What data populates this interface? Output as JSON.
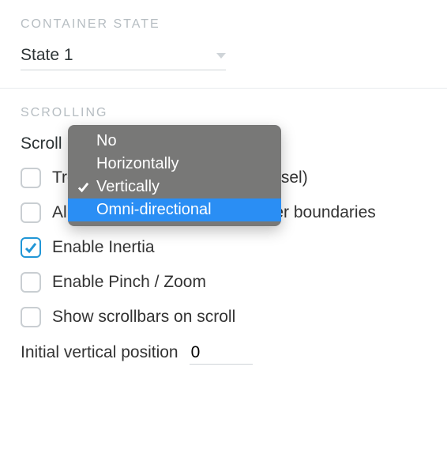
{
  "container_state": {
    "heading": "CONTAINER STATE",
    "selected": "State 1"
  },
  "scrolling": {
    "heading": "SCROLLING",
    "label_prefix": "Scroll",
    "dropdown_options": [
      "No",
      "Horizontally",
      "Vertically",
      "Omni-directional"
    ],
    "dropdown_selected_index": 2,
    "dropdown_highlight_index": 3,
    "checkboxes": [
      {
        "label": "Treat as carousel / snap (carousel)",
        "checked": false
      },
      {
        "label": "Allow scrolling beyond container boundaries",
        "checked": false
      },
      {
        "label": "Enable Inertia",
        "checked": true
      },
      {
        "label": "Enable Pinch / Zoom",
        "checked": false
      },
      {
        "label": "Show scrollbars on scroll",
        "checked": false
      }
    ],
    "initial_vertical_label": "Initial vertical position",
    "initial_vertical_value": "0"
  }
}
